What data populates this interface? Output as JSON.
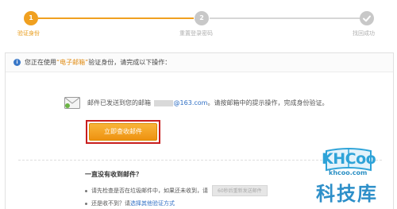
{
  "steps": [
    {
      "number": "1",
      "label": "验证身份"
    },
    {
      "number": "2",
      "label": "重置登录密码"
    },
    {
      "number": "",
      "label": "找回成功"
    }
  ],
  "notice": {
    "prefix": "您正在使用",
    "method": "“电子邮箱”",
    "suffix": "验证身份，请完成以下操作："
  },
  "mail": {
    "sent_text": "邮件已发送到您的邮箱",
    "domain": "@163.com",
    "instruction": "。请按邮箱中的提示操作，完成身份验证。"
  },
  "primary_button": {
    "label": "立即查收邮件"
  },
  "help": {
    "title": "一直没有收到邮件？",
    "tip1": "请先检查是否在垃圾邮件中，如果还未收到，请",
    "resend_label": "60秒后重新发送邮件",
    "tip2_prefix": "还是收不到？请",
    "tip2_link": "选择其他验证方式"
  },
  "watermark": {
    "brand": "KHCoo",
    "url": "khcoo.com",
    "name": "科技库"
  },
  "colors": {
    "accent": "#f0a020",
    "link": "#2f6fc4",
    "highlight_border": "#c81e1e"
  }
}
